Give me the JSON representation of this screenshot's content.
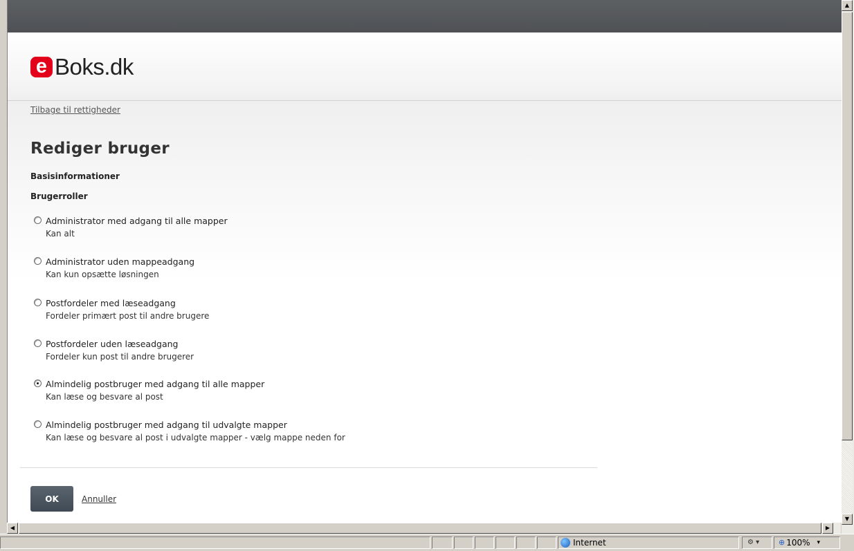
{
  "brand": {
    "badge": "e",
    "word": "Boks.dk",
    "badge_color": "#e3001b"
  },
  "nav": {
    "back_link": "Tilbage til rettigheder"
  },
  "page": {
    "title": "Rediger bruger"
  },
  "sections": {
    "basic_info": "Basisinformationer",
    "roles": "Brugerroller"
  },
  "roles": [
    {
      "title": "Administrator med adgang til alle mapper",
      "desc": "Kan alt",
      "checked": false
    },
    {
      "title": "Administrator uden mappeadgang",
      "desc": "Kan kun opsætte løsningen",
      "checked": false
    },
    {
      "title": "Postfordeler med læseadgang",
      "desc": "Fordeler primært post til andre brugere",
      "checked": false
    },
    {
      "title": "Postfordeler uden læseadgang",
      "desc": "Fordeler kun post til andre brugerer",
      "checked": false
    },
    {
      "title": "Almindelig postbruger med adgang til alle mapper",
      "desc": "Kan læse og besvare al post",
      "checked": true
    },
    {
      "title": "Almindelig postbruger med adgang til udvalgte mapper",
      "desc": "Kan læse og besvare al post i udvalgte mapper - vælg mappe neden for",
      "checked": false
    }
  ],
  "actions": {
    "ok": "OK",
    "cancel": "Annuller"
  },
  "statusbar": {
    "zone": "Internet",
    "zoom": "100%"
  }
}
